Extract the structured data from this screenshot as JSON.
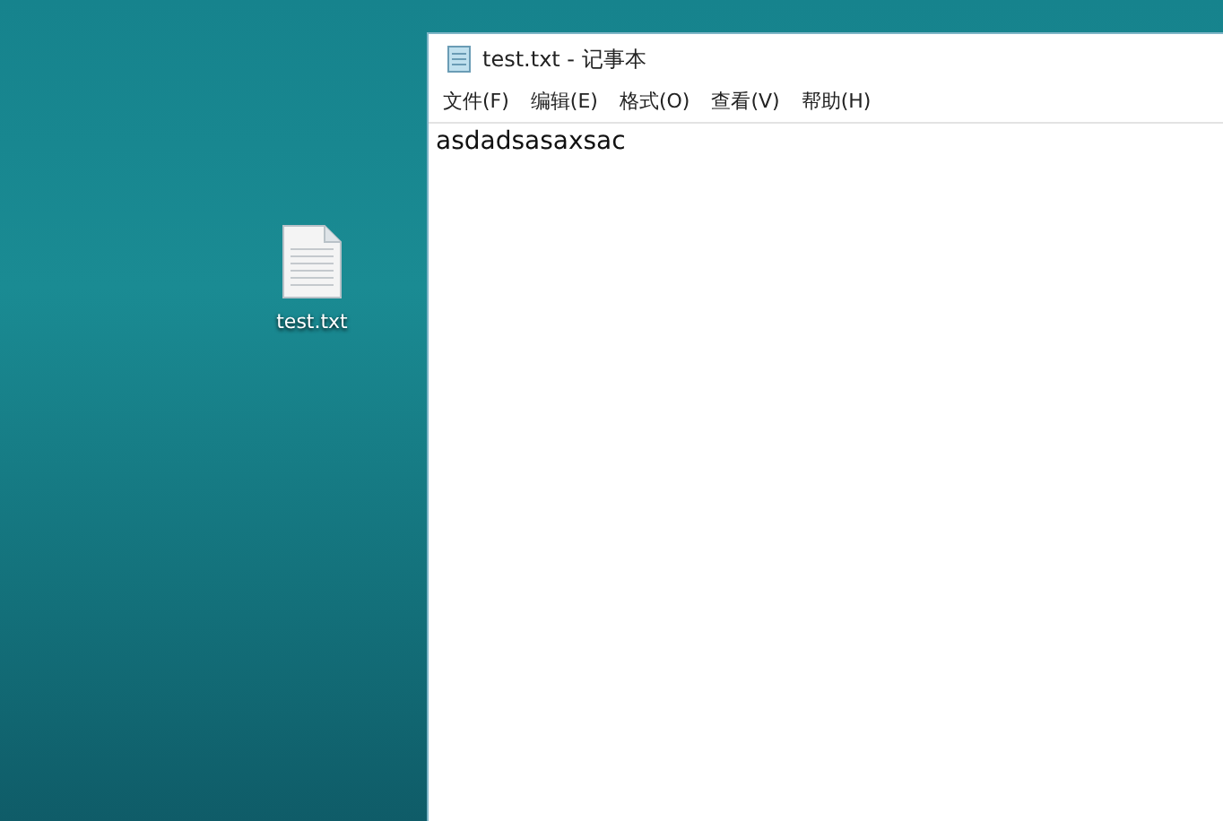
{
  "desktop": {
    "icons": [
      {
        "label": "test.txt"
      }
    ]
  },
  "window": {
    "title": "test.txt - 记事本",
    "menu": [
      {
        "label": "文件(F)"
      },
      {
        "label": "编辑(E)"
      },
      {
        "label": "格式(O)"
      },
      {
        "label": "查看(V)"
      },
      {
        "label": "帮助(H)"
      }
    ],
    "content": "asdadsasaxsac"
  }
}
